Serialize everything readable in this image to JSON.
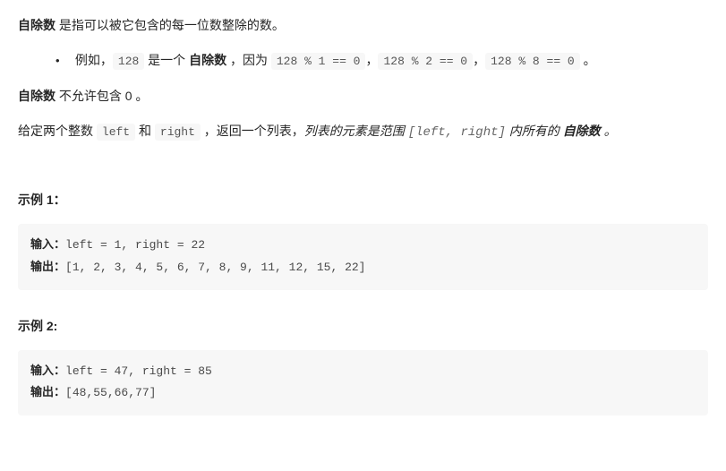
{
  "intro": {
    "term1": "自除数",
    "text1": " 是指可以被它包含的每一位数整除的数。"
  },
  "bullet": {
    "prefix": "例如，",
    "num": "128",
    "mid": " 是一个 ",
    "bold": "自除数",
    "sep": " ，因为 ",
    "c1": "128 % 1 == 0",
    "comma1": "，",
    "c2": "128 % 2 == 0",
    "comma2": "，",
    "c3": "128 % 8 == 0",
    "period": " 。"
  },
  "rule": {
    "term": "自除数",
    "text": " 不允许包含 0 。"
  },
  "task": {
    "t1": "给定两个整数 ",
    "left": "left",
    "t2": " 和 ",
    "right": "right",
    "t3": " ，返回一个列表，",
    "em1": "列表的元素是范围 ",
    "range": "[left, right]",
    "em2": " 内所有的 ",
    "bold": "自除数",
    "em3": " 。"
  },
  "examples": {
    "ex1": {
      "heading": "示例 1：",
      "inputLabel": "输入：",
      "inputText": "left = 1, right = 22",
      "outputLabel": "输出：",
      "outputText": "[1, 2, 3, 4, 5, 6, 7, 8, 9, 11, 12, 15, 22]"
    },
    "ex2": {
      "heading": "示例 2:",
      "inputLabel": "输入：",
      "inputText": "left = 47, right = 85",
      "outputLabel": "输出：",
      "outputText": "[48,55,66,77]"
    }
  }
}
